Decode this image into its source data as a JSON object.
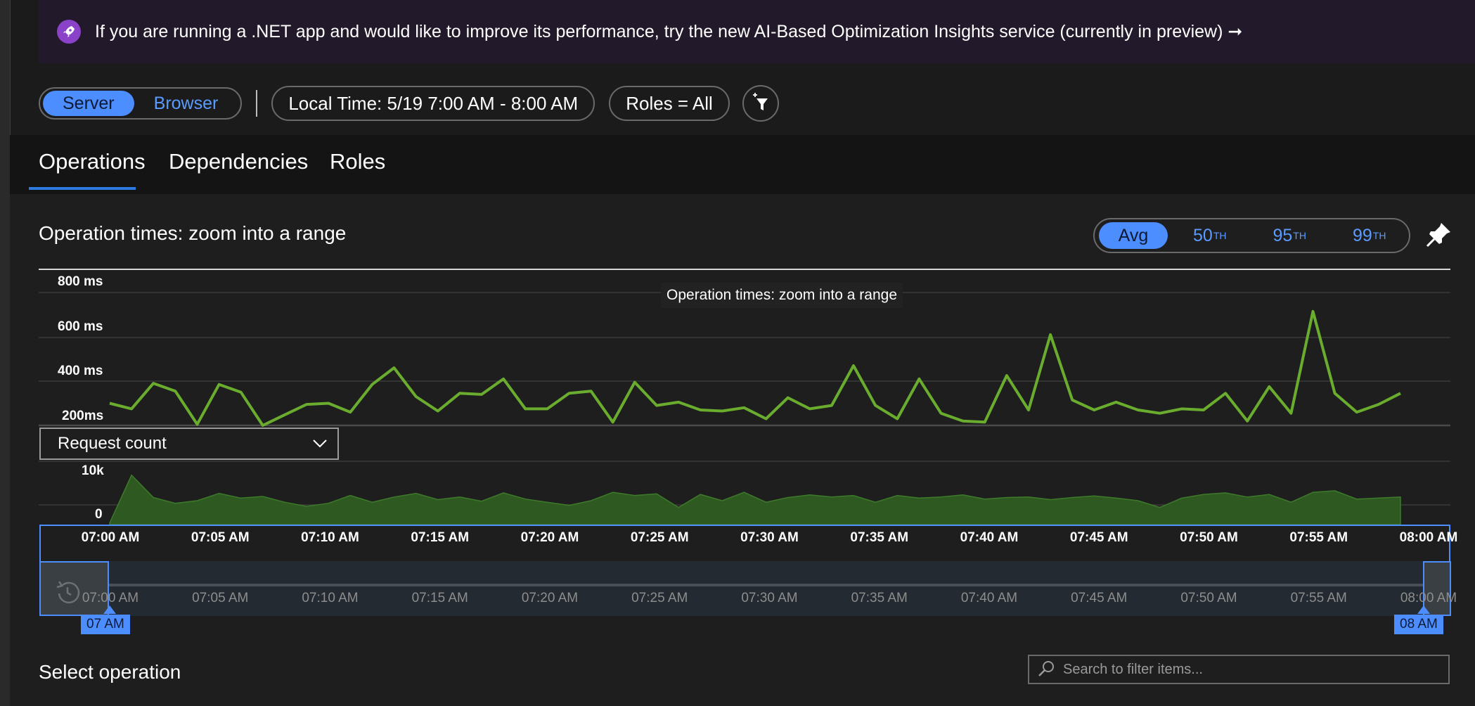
{
  "banner": {
    "text": "If you are running a .NET app and would like to improve its performance, try the new AI-Based Optimization Insights service (currently in preview) ➞",
    "icon": "rocket-icon"
  },
  "toolbar": {
    "toggle": {
      "server_label": "Server",
      "browser_label": "Browser",
      "selected": "Server"
    },
    "time_range": "Local Time: 5/19 7:00 AM - 8:00 AM",
    "roles_filter": "Roles = All",
    "add_filter_icon": "add-filter-icon"
  },
  "tabs": [
    {
      "label": "Operations",
      "active": true
    },
    {
      "label": "Dependencies",
      "active": false
    },
    {
      "label": "Roles",
      "active": false
    }
  ],
  "chart_section": {
    "title": "Operation times: zoom into a range",
    "tooltip": "Operation times: zoom into a range",
    "percentiles": {
      "avg": "Avg",
      "p50": "50",
      "p50_suffix": "TH",
      "p95": "95",
      "p95_suffix": "TH",
      "p99": "99",
      "p99_suffix": "TH",
      "selected": "Avg"
    },
    "pin_icon": "pin-icon",
    "metric_dropdown": {
      "value": "Request count"
    }
  },
  "chart_data": [
    {
      "type": "line",
      "ylabels": [
        "800 ms",
        "600 ms",
        "400 ms",
        "200ms"
      ],
      "ylim": [
        200,
        800
      ],
      "grid": true,
      "color": "#6aad2e",
      "x_start": "07:00 AM",
      "x_end": "08:00 AM",
      "values": [
        300,
        275,
        390,
        355,
        205,
        385,
        350,
        200,
        248,
        295,
        300,
        260,
        385,
        460,
        330,
        265,
        345,
        340,
        410,
        275,
        275,
        345,
        355,
        215,
        395,
        290,
        305,
        270,
        265,
        280,
        230,
        325,
        275,
        290,
        470,
        290,
        230,
        410,
        255,
        220,
        215,
        425,
        270,
        610,
        315,
        270,
        305,
        270,
        255,
        275,
        270,
        345,
        220,
        375,
        255,
        715,
        345,
        260,
        295,
        345
      ]
    },
    {
      "type": "area",
      "ylabels": [
        "10k",
        "0"
      ],
      "ylim": [
        0,
        10000
      ],
      "color": "#2e5a22",
      "values": [
        300,
        9500,
        5200,
        4100,
        4600,
        6000,
        5100,
        5400,
        4300,
        3500,
        4100,
        5600,
        4300,
        5300,
        6000,
        4800,
        5300,
        4500,
        6100,
        4900,
        4300,
        3700,
        4600,
        6200,
        5600,
        5900,
        3300,
        5800,
        4600,
        6200,
        4300,
        5200,
        5700,
        5300,
        5600,
        4300,
        5600,
        5100,
        5300,
        5700,
        4900,
        5200,
        5300,
        4800,
        5200,
        5500,
        5100,
        4600,
        3300,
        5100,
        5800,
        6100,
        5300,
        5800,
        4300,
        6200,
        6500,
        4900,
        5100,
        5300
      ]
    },
    {
      "type": "axis",
      "xticks": [
        "07:00 AM",
        "07:05 AM",
        "07:10 AM",
        "07:15 AM",
        "07:20 AM",
        "07:25 AM",
        "07:30 AM",
        "07:35 AM",
        "07:40 AM",
        "07:45 AM",
        "07:50 AM",
        "07:55 AM",
        "08:00 AM"
      ]
    }
  ],
  "time_brush": {
    "xticks": [
      "07:00 AM",
      "07:05 AM",
      "07:10 AM",
      "07:15 AM",
      "07:20 AM",
      "07:25 AM",
      "07:30 AM",
      "07:35 AM",
      "07:40 AM",
      "07:45 AM",
      "07:50 AM",
      "07:55 AM",
      "08:00 AM"
    ],
    "start_label": "07 AM",
    "end_label": "08 AM",
    "reset_icon": "reset-zoom-icon"
  },
  "operations": {
    "title": "Select operation",
    "search_placeholder": "Search to filter items..."
  }
}
